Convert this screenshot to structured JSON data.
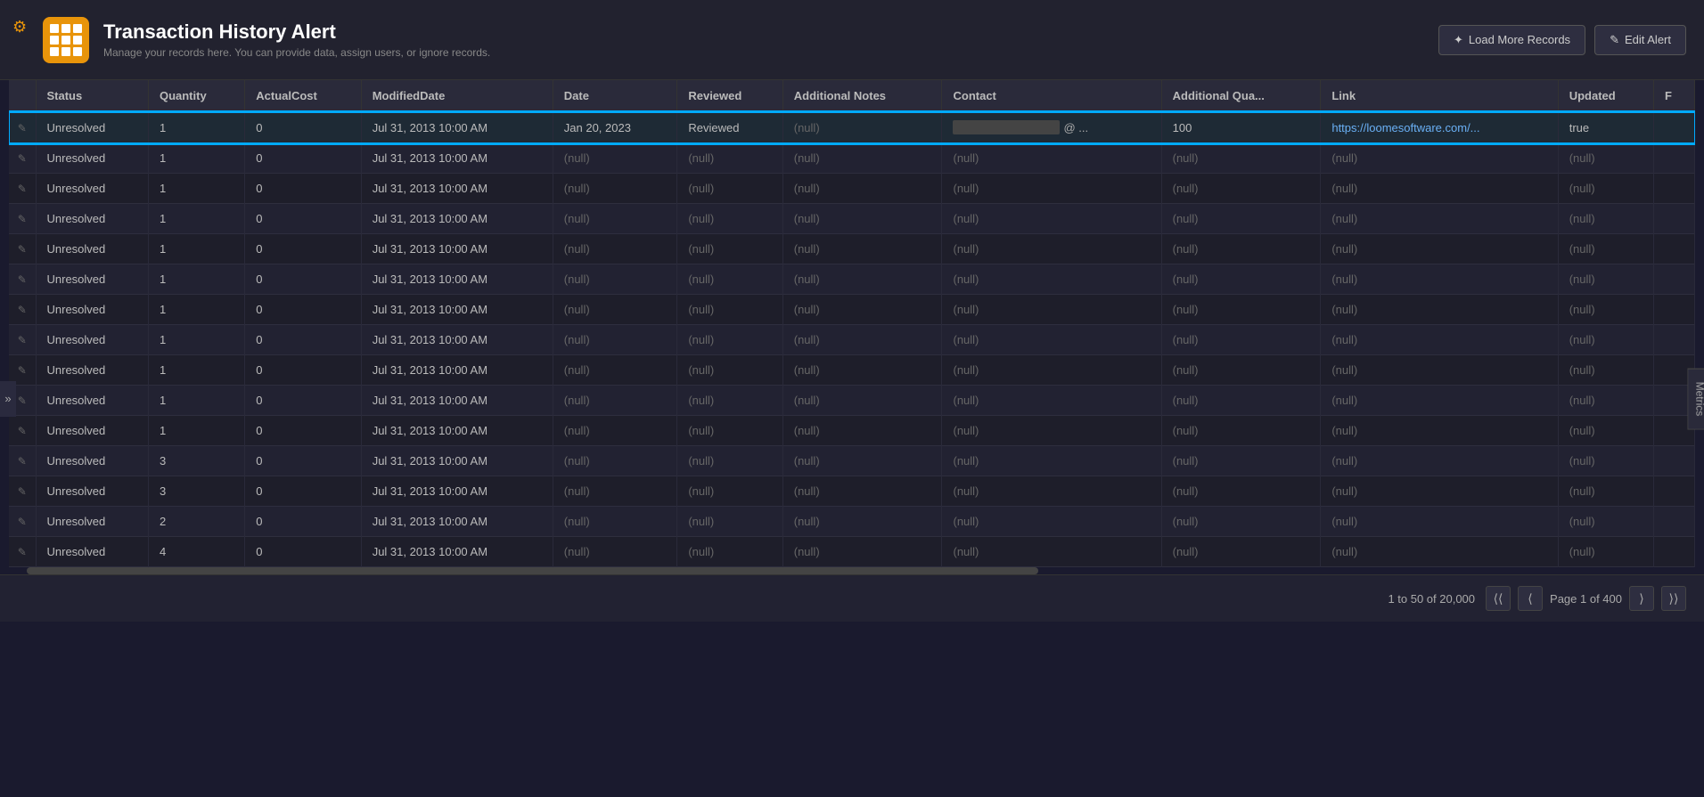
{
  "app": {
    "settings_icon": "⚙",
    "title": "Transaction History Alert",
    "subtitle": "Manage your records here. You can provide data, assign users, or ignore records.",
    "icon_color": "#e8940a"
  },
  "actions": {
    "load_more_label": "Load More Records",
    "edit_alert_label": "Edit Alert"
  },
  "table": {
    "columns": [
      "",
      "Status",
      "Quantity",
      "ActualCost",
      "ModifiedDate",
      "Date",
      "Reviewed",
      "Additional Notes",
      "Contact",
      "Additional Qua...",
      "Link",
      "Updated",
      "F"
    ],
    "highlighted_row": 0,
    "rows": [
      {
        "edit": "✎",
        "status": "Unresolved",
        "quantity": "1",
        "actualCost": "0",
        "modifiedDate": "Jul 31, 2013 10:00 AM",
        "date": "Jan 20, 2023",
        "reviewed": "Reviewed",
        "additionalNotes": "(null)",
        "contact": "email_blurred",
        "additionalQua": "100",
        "link": "https://loomesoftware.com/...",
        "updated": "true",
        "f": ""
      },
      {
        "edit": "✎",
        "status": "Unresolved",
        "quantity": "1",
        "actualCost": "0",
        "modifiedDate": "Jul 31, 2013 10:00 AM",
        "date": "(null)",
        "reviewed": "(null)",
        "additionalNotes": "(null)",
        "contact": "(null)",
        "additionalQua": "(null)",
        "link": "(null)",
        "updated": "(null)",
        "f": ""
      },
      {
        "edit": "✎",
        "status": "Unresolved",
        "quantity": "1",
        "actualCost": "0",
        "modifiedDate": "Jul 31, 2013 10:00 AM",
        "date": "(null)",
        "reviewed": "(null)",
        "additionalNotes": "(null)",
        "contact": "(null)",
        "additionalQua": "(null)",
        "link": "(null)",
        "updated": "(null)",
        "f": ""
      },
      {
        "edit": "✎",
        "status": "Unresolved",
        "quantity": "1",
        "actualCost": "0",
        "modifiedDate": "Jul 31, 2013 10:00 AM",
        "date": "(null)",
        "reviewed": "(null)",
        "additionalNotes": "(null)",
        "contact": "(null)",
        "additionalQua": "(null)",
        "link": "(null)",
        "updated": "(null)",
        "f": ""
      },
      {
        "edit": "✎",
        "status": "Unresolved",
        "quantity": "1",
        "actualCost": "0",
        "modifiedDate": "Jul 31, 2013 10:00 AM",
        "date": "(null)",
        "reviewed": "(null)",
        "additionalNotes": "(null)",
        "contact": "(null)",
        "additionalQua": "(null)",
        "link": "(null)",
        "updated": "(null)",
        "f": ""
      },
      {
        "edit": "✎",
        "status": "Unresolved",
        "quantity": "1",
        "actualCost": "0",
        "modifiedDate": "Jul 31, 2013 10:00 AM",
        "date": "(null)",
        "reviewed": "(null)",
        "additionalNotes": "(null)",
        "contact": "(null)",
        "additionalQua": "(null)",
        "link": "(null)",
        "updated": "(null)",
        "f": ""
      },
      {
        "edit": "✎",
        "status": "Unresolved",
        "quantity": "1",
        "actualCost": "0",
        "modifiedDate": "Jul 31, 2013 10:00 AM",
        "date": "(null)",
        "reviewed": "(null)",
        "additionalNotes": "(null)",
        "contact": "(null)",
        "additionalQua": "(null)",
        "link": "(null)",
        "updated": "(null)",
        "f": ""
      },
      {
        "edit": "✎",
        "status": "Unresolved",
        "quantity": "1",
        "actualCost": "0",
        "modifiedDate": "Jul 31, 2013 10:00 AM",
        "date": "(null)",
        "reviewed": "(null)",
        "additionalNotes": "(null)",
        "contact": "(null)",
        "additionalQua": "(null)",
        "link": "(null)",
        "updated": "(null)",
        "f": ""
      },
      {
        "edit": "✎",
        "status": "Unresolved",
        "quantity": "1",
        "actualCost": "0",
        "modifiedDate": "Jul 31, 2013 10:00 AM",
        "date": "(null)",
        "reviewed": "(null)",
        "additionalNotes": "(null)",
        "contact": "(null)",
        "additionalQua": "(null)",
        "link": "(null)",
        "updated": "(null)",
        "f": ""
      },
      {
        "edit": "✎",
        "status": "Unresolved",
        "quantity": "1",
        "actualCost": "0",
        "modifiedDate": "Jul 31, 2013 10:00 AM",
        "date": "(null)",
        "reviewed": "(null)",
        "additionalNotes": "(null)",
        "contact": "(null)",
        "additionalQua": "(null)",
        "link": "(null)",
        "updated": "(null)",
        "f": ""
      },
      {
        "edit": "✎",
        "status": "Unresolved",
        "quantity": "1",
        "actualCost": "0",
        "modifiedDate": "Jul 31, 2013 10:00 AM",
        "date": "(null)",
        "reviewed": "(null)",
        "additionalNotes": "(null)",
        "contact": "(null)",
        "additionalQua": "(null)",
        "link": "(null)",
        "updated": "(null)",
        "f": ""
      },
      {
        "edit": "✎",
        "status": "Unresolved",
        "quantity": "3",
        "actualCost": "0",
        "modifiedDate": "Jul 31, 2013 10:00 AM",
        "date": "(null)",
        "reviewed": "(null)",
        "additionalNotes": "(null)",
        "contact": "(null)",
        "additionalQua": "(null)",
        "link": "(null)",
        "updated": "(null)",
        "f": ""
      },
      {
        "edit": "✎",
        "status": "Unresolved",
        "quantity": "3",
        "actualCost": "0",
        "modifiedDate": "Jul 31, 2013 10:00 AM",
        "date": "(null)",
        "reviewed": "(null)",
        "additionalNotes": "(null)",
        "contact": "(null)",
        "additionalQua": "(null)",
        "link": "(null)",
        "updated": "(null)",
        "f": ""
      },
      {
        "edit": "✎",
        "status": "Unresolved",
        "quantity": "2",
        "actualCost": "0",
        "modifiedDate": "Jul 31, 2013 10:00 AM",
        "date": "(null)",
        "reviewed": "(null)",
        "additionalNotes": "(null)",
        "contact": "(null)",
        "additionalQua": "(null)",
        "link": "(null)",
        "updated": "(null)",
        "f": ""
      },
      {
        "edit": "✎",
        "status": "Unresolved",
        "quantity": "4",
        "actualCost": "0",
        "modifiedDate": "Jul 31, 2013 10:00 AM",
        "date": "(null)",
        "reviewed": "(null)",
        "additionalNotes": "(null)",
        "contact": "(null)",
        "additionalQua": "(null)",
        "link": "(null)",
        "updated": "(null)",
        "f": ""
      }
    ]
  },
  "pagination": {
    "range_text": "1 to 50 of 20,000",
    "page_text": "Page 1 of 400",
    "first_icon": "⟨⟨",
    "prev_icon": "⟨",
    "next_icon": "⟩",
    "last_icon": "⟩⟩"
  },
  "metrics_tab_label": "Metrics",
  "sidebar_arrow": "»"
}
